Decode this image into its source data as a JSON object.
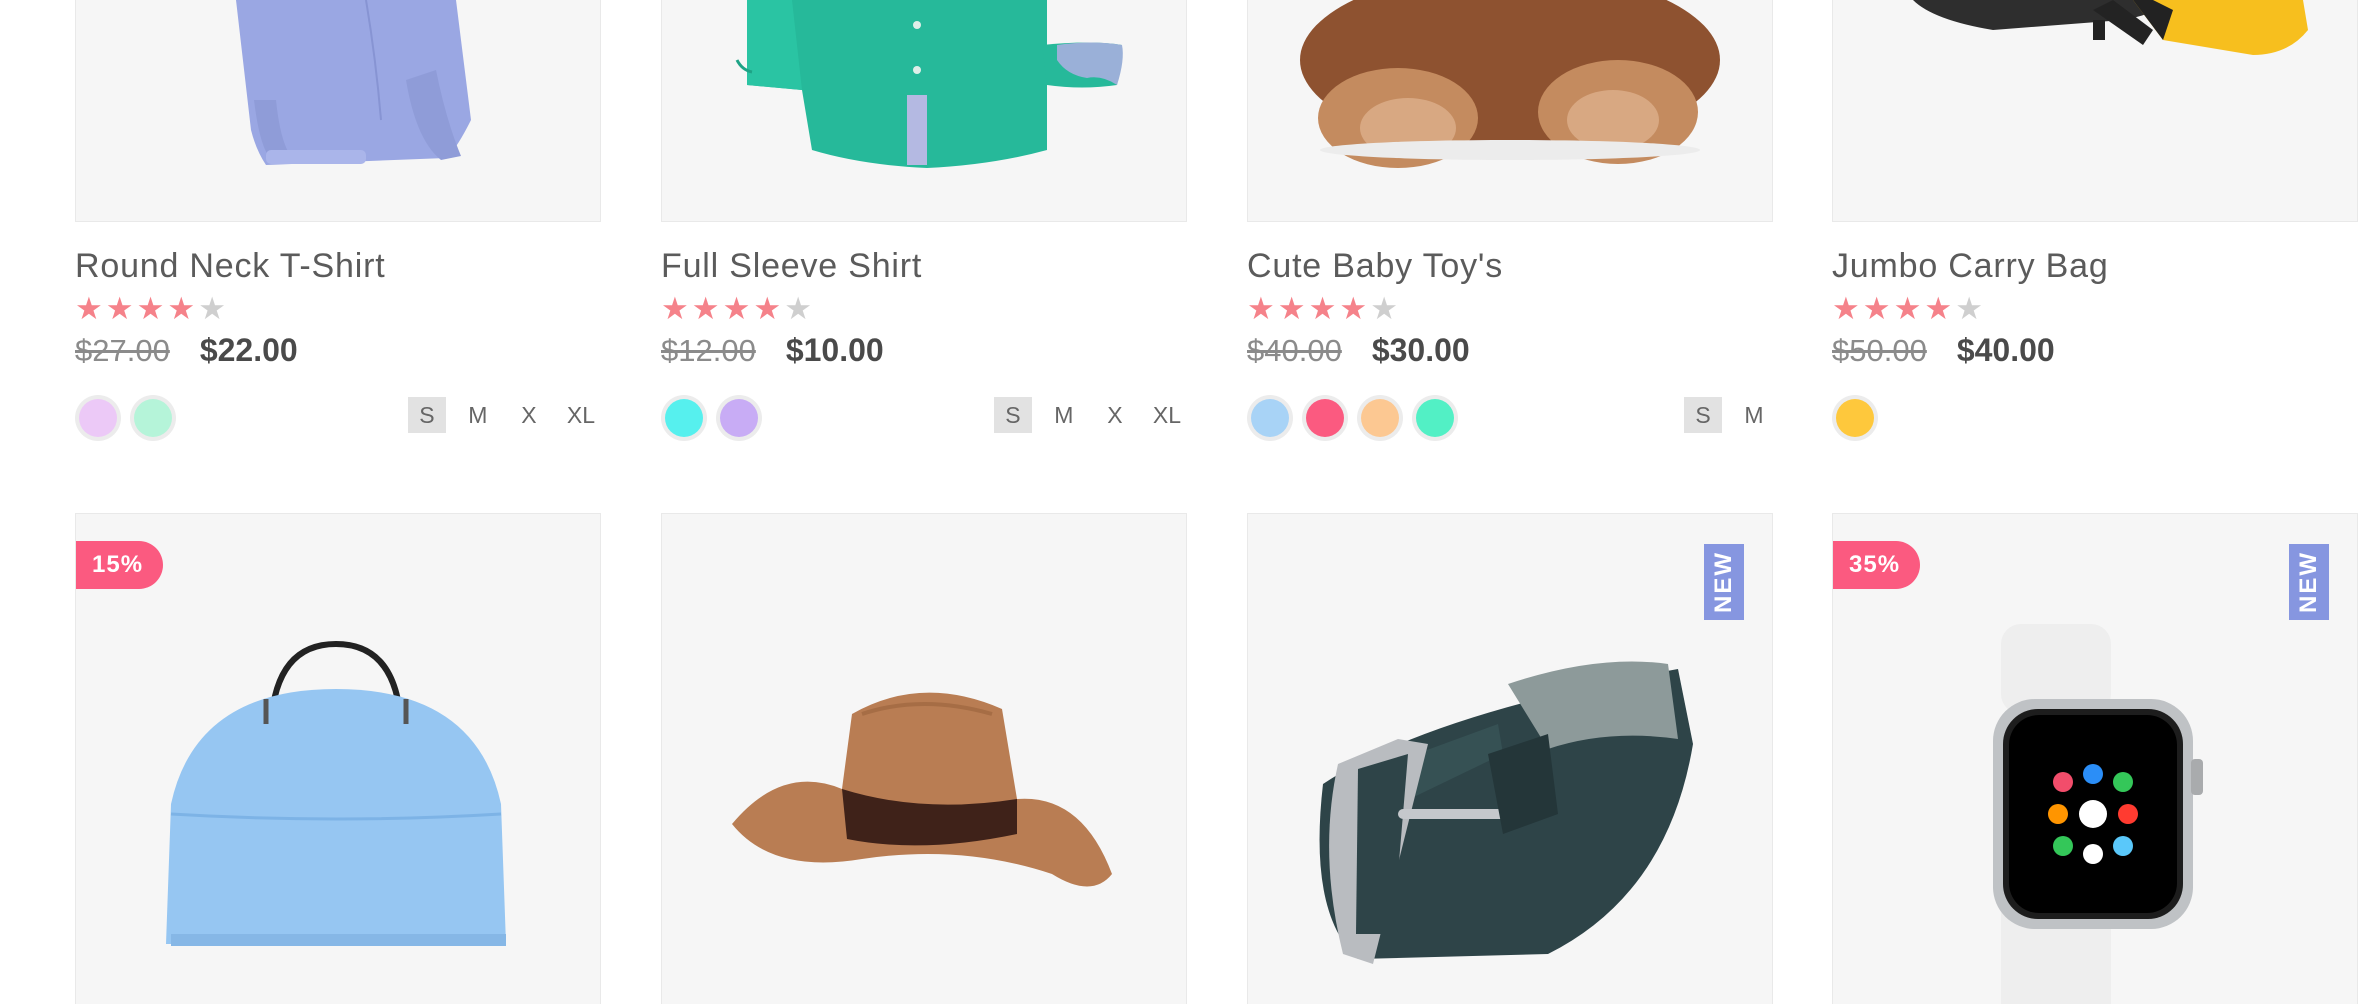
{
  "products": [
    {
      "title": "Round Neck T-Shirt",
      "rating": 4,
      "old_price": "$27.00",
      "new_price": "$22.00",
      "colors": [
        "#ecc9f7",
        "#b5f4d9"
      ],
      "sizes": [
        "S",
        "M",
        "X",
        "XL"
      ],
      "active_size": "S"
    },
    {
      "title": "Full Sleeve Shirt",
      "rating": 4,
      "old_price": "$12.00",
      "new_price": "$10.00",
      "colors": [
        "#56f0ee",
        "#c8acf5"
      ],
      "sizes": [
        "S",
        "M",
        "X",
        "XL"
      ],
      "active_size": "S"
    },
    {
      "title": "Cute Baby Toy's",
      "rating": 4,
      "old_price": "$40.00",
      "new_price": "$30.00",
      "colors": [
        "#a8d3f6",
        "#fb5a80",
        "#fcc892",
        "#52f0c5"
      ],
      "sizes": [
        "S",
        "M"
      ],
      "active_size": "S"
    },
    {
      "title": "Jumbo Carry Bag",
      "rating": 4,
      "old_price": "$50.00",
      "new_price": "$40.00",
      "colors": [
        "#fec83c"
      ],
      "sizes": [],
      "active_size": ""
    }
  ],
  "row2": [
    {
      "discount": "15%",
      "new_badge": ""
    },
    {
      "discount": "",
      "new_badge": ""
    },
    {
      "discount": "",
      "new_badge": "NEW"
    },
    {
      "discount": "35%",
      "new_badge": "NEW"
    }
  ],
  "star_icon": "★",
  "theme": {
    "accent": "#fb5a80",
    "star": "#f5828a",
    "new_badge": "#8696e0"
  }
}
